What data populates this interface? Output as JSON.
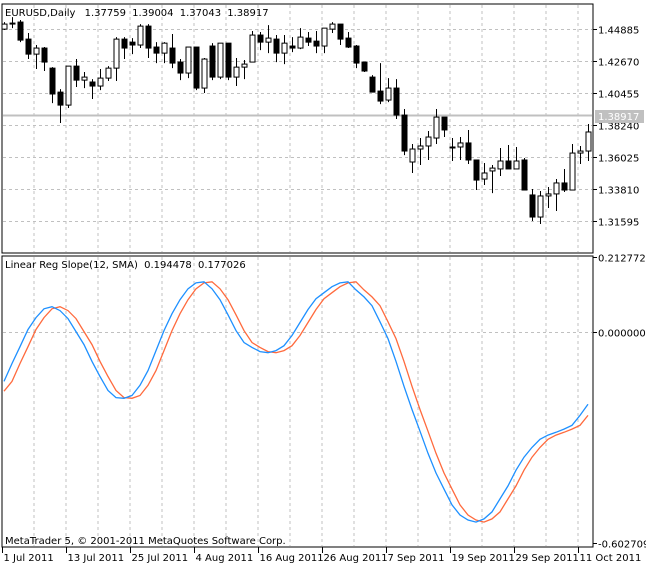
{
  "header": {
    "symbol_timeframe": "EURUSD,Daily",
    "open": "1.37759",
    "high": "1.39004",
    "low": "1.37043",
    "close": "1.38917"
  },
  "indicator_label": {
    "name": "Linear Reg Slope(12, SMA)",
    "value_main": "0.194478",
    "value_signal": "0.177026"
  },
  "copyright": "MetaTrader 5, © 2001-2011 MetaQuotes Software Corp.",
  "current_price_label": "1.38917",
  "colors": {
    "bull_body": "#ffffff",
    "bear_body": "#000000",
    "main_line": "#1e90ff",
    "signal_line": "#ff6a3d",
    "grid": "#c0c0c0",
    "price_line": "#c0c0c0"
  },
  "chart_data": [
    {
      "type": "candlestick",
      "title": "EURUSD,Daily",
      "grid": true,
      "current_price": 1.38917,
      "y_ticks": [
        "1.44885",
        "1.42670",
        "1.40455",
        "1.38240",
        "1.36025",
        "1.33810",
        "1.31595"
      ],
      "ylim": [
        1.2938,
        1.4669
      ],
      "candles_ohlc": [
        [
          1.4488,
          1.4537,
          1.4482,
          1.4523
        ],
        [
          1.453,
          1.4571,
          1.4495,
          1.453
        ],
        [
          1.4537,
          1.4551,
          1.4398,
          1.4412
        ],
        [
          1.4419,
          1.4461,
          1.4281,
          1.4315
        ],
        [
          1.4315,
          1.4378,
          1.4212,
          1.4357
        ],
        [
          1.4357,
          1.4364,
          1.4198,
          1.426
        ],
        [
          1.4218,
          1.4225,
          1.3976,
          1.4039
        ],
        [
          1.4052,
          1.4073,
          1.3838,
          1.3962
        ],
        [
          1.3962,
          1.4232,
          1.3942,
          1.4232
        ],
        [
          1.4232,
          1.4281,
          1.4087,
          1.4135
        ],
        [
          1.4135,
          1.4191,
          1.408,
          1.4156
        ],
        [
          1.4122,
          1.4142,
          1.4004,
          1.4094
        ],
        [
          1.4094,
          1.4212,
          1.4066,
          1.4149
        ],
        [
          1.4149,
          1.4232,
          1.4129,
          1.4218
        ],
        [
          1.4218,
          1.4433,
          1.4129,
          1.4419
        ],
        [
          1.4419,
          1.4433,
          1.4281,
          1.4357
        ],
        [
          1.4398,
          1.4426,
          1.4315,
          1.4378
        ],
        [
          1.4378,
          1.4523,
          1.4357,
          1.4509
        ],
        [
          1.4509,
          1.4523,
          1.4288,
          1.4357
        ],
        [
          1.4364,
          1.4398,
          1.4253,
          1.4322
        ],
        [
          1.4322,
          1.4398,
          1.4253,
          1.4391
        ],
        [
          1.4357,
          1.4454,
          1.4218,
          1.4253
        ],
        [
          1.426,
          1.4281,
          1.4135,
          1.4184
        ],
        [
          1.4184,
          1.4364,
          1.4149,
          1.4364
        ],
        [
          1.4364,
          1.4364,
          1.4066,
          1.408
        ],
        [
          1.408,
          1.4288,
          1.4046,
          1.4281
        ],
        [
          1.4371,
          1.4391,
          1.4135,
          1.4156
        ],
        [
          1.4156,
          1.4391,
          1.4142,
          1.4391
        ],
        [
          1.4391,
          1.4391,
          1.4135,
          1.4156
        ],
        [
          1.4156,
          1.4288,
          1.4094,
          1.4225
        ],
        [
          1.4225,
          1.4274,
          1.4142,
          1.4246
        ],
        [
          1.426,
          1.4475,
          1.426,
          1.4447
        ],
        [
          1.4447,
          1.4468,
          1.4343,
          1.4398
        ],
        [
          1.4398,
          1.4516,
          1.4322,
          1.4426
        ],
        [
          1.4419,
          1.4447,
          1.426,
          1.4322
        ],
        [
          1.4322,
          1.4447,
          1.4246,
          1.4391
        ],
        [
          1.4371,
          1.4433,
          1.4329,
          1.4357
        ],
        [
          1.4357,
          1.4495,
          1.435,
          1.4433
        ],
        [
          1.4426,
          1.4468,
          1.4371,
          1.4398
        ],
        [
          1.4405,
          1.4475,
          1.4322,
          1.4371
        ],
        [
          1.4371,
          1.4495,
          1.4322,
          1.4495
        ],
        [
          1.4488,
          1.4537,
          1.4461,
          1.4523
        ],
        [
          1.4523,
          1.4523,
          1.4378,
          1.4419
        ],
        [
          1.4426,
          1.4468,
          1.4357,
          1.4364
        ],
        [
          1.4371,
          1.4378,
          1.4218,
          1.4253
        ],
        [
          1.426,
          1.426,
          1.4191,
          1.4198
        ],
        [
          1.4156,
          1.417,
          1.4052,
          1.4052
        ],
        [
          1.4059,
          1.4253,
          1.3969,
          1.399
        ],
        [
          1.3997,
          1.4149,
          1.3983,
          1.408
        ],
        [
          1.408,
          1.4142,
          1.3866,
          1.3893
        ],
        [
          1.3893,
          1.3935,
          1.3616,
          1.3644
        ],
        [
          1.3568,
          1.3693,
          1.3492,
          1.3658
        ],
        [
          1.3658,
          1.3734,
          1.3547,
          1.3679
        ],
        [
          1.3679,
          1.3783,
          1.3582,
          1.3741
        ],
        [
          1.3734,
          1.3935,
          1.3693,
          1.3879
        ],
        [
          1.3879,
          1.3879,
          1.3741,
          1.379
        ],
        [
          1.3672,
          1.3734,
          1.3575,
          1.3672
        ],
        [
          1.3672,
          1.3741,
          1.3582,
          1.37
        ],
        [
          1.37,
          1.379,
          1.3554,
          1.3582
        ],
        [
          1.3582,
          1.3582,
          1.3374,
          1.3443
        ],
        [
          1.345,
          1.3561,
          1.3409,
          1.3492
        ],
        [
          1.3506,
          1.3547,
          1.3353,
          1.3526
        ],
        [
          1.352,
          1.3665,
          1.3471,
          1.3575
        ],
        [
          1.3575,
          1.3686,
          1.352,
          1.352
        ],
        [
          1.352,
          1.3672,
          1.352,
          1.3575
        ],
        [
          1.3582,
          1.3596,
          1.3374,
          1.3374
        ],
        [
          1.334,
          1.3381,
          1.316,
          1.3187
        ],
        [
          1.3187,
          1.3367,
          1.3139,
          1.3333
        ],
        [
          1.3333,
          1.3395,
          1.325,
          1.3347
        ],
        [
          1.3347,
          1.345,
          1.3229,
          1.3423
        ],
        [
          1.3423,
          1.352,
          1.336,
          1.3374
        ],
        [
          1.3374,
          1.3693,
          1.3374,
          1.363
        ],
        [
          1.363,
          1.3679,
          1.3554,
          1.3644
        ],
        [
          1.3644,
          1.3831,
          1.3575,
          1.3776
        ]
      ],
      "x_tick_labels": [
        "1 Jul 2011",
        "13 Jul 2011",
        "25 Jul 2011",
        "4 Aug 2011",
        "16 Aug 2011",
        "26 Aug 2011",
        "7 Sep 2011",
        "19 Sep 2011",
        "29 Sep 2011",
        "11 Oct 2011"
      ]
    },
    {
      "type": "line",
      "title": "Linear Reg Slope(12, SMA)",
      "grid": true,
      "y_ticks": [
        "0.212772",
        "0.000000",
        "-0.602709"
      ],
      "ylim": [
        -0.602709,
        0.212772
      ],
      "series": [
        {
          "values": [
            -0.142,
            -0.091,
            -0.043,
            0.006,
            0.04,
            0.065,
            0.071,
            0.06,
            0.037,
            0.0,
            -0.037,
            -0.085,
            -0.128,
            -0.168,
            -0.188,
            -0.19,
            -0.182,
            -0.153,
            -0.111,
            -0.054,
            0.003,
            0.051,
            0.091,
            0.122,
            0.139,
            0.142,
            0.122,
            0.091,
            0.048,
            0.003,
            -0.031,
            -0.045,
            -0.057,
            -0.06,
            -0.054,
            -0.04,
            -0.011,
            0.026,
            0.063,
            0.094,
            0.111,
            0.128,
            0.139,
            0.142,
            0.119,
            0.099,
            0.074,
            0.028,
            -0.02,
            -0.085,
            -0.156,
            -0.222,
            -0.284,
            -0.347,
            -0.403,
            -0.449,
            -0.494,
            -0.523,
            -0.537,
            -0.543,
            -0.534,
            -0.514,
            -0.477,
            -0.44,
            -0.395,
            -0.358,
            -0.33,
            -0.307,
            -0.295,
            -0.287,
            -0.278,
            -0.267,
            -0.239,
            -0.207
          ]
        },
        {
          "values": [
            -0.17,
            -0.142,
            -0.091,
            -0.043,
            0.006,
            0.04,
            0.065,
            0.071,
            0.06,
            0.037,
            0.0,
            -0.037,
            -0.085,
            -0.128,
            -0.168,
            -0.188,
            -0.19,
            -0.182,
            -0.153,
            -0.111,
            -0.054,
            0.003,
            0.051,
            0.091,
            0.122,
            0.139,
            0.142,
            0.122,
            0.091,
            0.048,
            0.003,
            -0.031,
            -0.045,
            -0.057,
            -0.06,
            -0.054,
            -0.04,
            -0.011,
            0.026,
            0.063,
            0.094,
            0.111,
            0.128,
            0.139,
            0.142,
            0.119,
            0.099,
            0.074,
            0.028,
            -0.02,
            -0.085,
            -0.156,
            -0.222,
            -0.284,
            -0.347,
            -0.403,
            -0.449,
            -0.494,
            -0.523,
            -0.537,
            -0.543,
            -0.534,
            -0.514,
            -0.477,
            -0.44,
            -0.395,
            -0.358,
            -0.33,
            -0.307,
            -0.295,
            -0.287,
            -0.278,
            -0.267,
            -0.239
          ]
        }
      ]
    }
  ]
}
